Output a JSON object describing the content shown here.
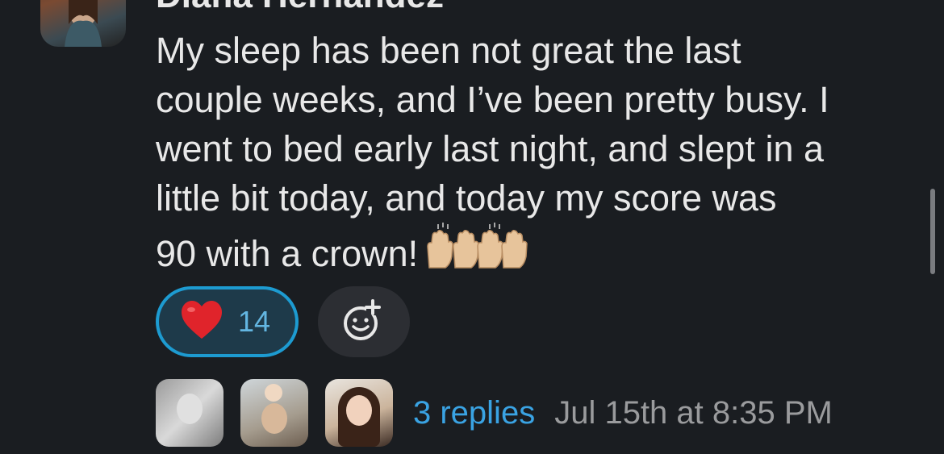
{
  "message": {
    "author": "Diana Hernandez",
    "text": "My sleep has been not great the last\ncouple weeks, and I’ve been pretty busy. I\nwent to bed early last night, and slept in a\nlittle bit today, and today my score was\n90 with a crown!",
    "inline_emoji": "raising-hands-emoji"
  },
  "reactions": [
    {
      "emoji": "red-heart",
      "count": "14",
      "selected": true
    }
  ],
  "add_reaction": {
    "icon": "add-emoji-icon"
  },
  "thread": {
    "replies_label": "3 replies",
    "timestamp": "Jul 15th at 8:35 PM"
  },
  "colors": {
    "background": "#1a1d21",
    "accent": "#1d9bd1",
    "link": "#3aa3e3",
    "muted": "#9a9b9d"
  }
}
